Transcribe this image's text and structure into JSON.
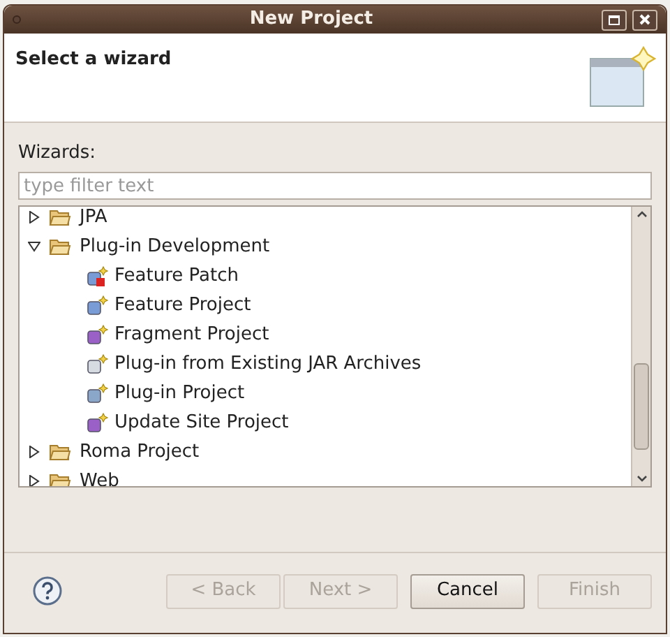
{
  "window": {
    "title": "New Project"
  },
  "header": {
    "title": "Select a wizard"
  },
  "wizards_label": {
    "text": "Wizards:"
  },
  "filter": {
    "placeholder": "type filter text"
  },
  "tree": [
    {
      "label": "JPA",
      "kind": "folder",
      "expanded": false
    },
    {
      "label": "Plug-in Development",
      "kind": "folder",
      "expanded": true,
      "children": [
        {
          "label": "Feature Patch",
          "kind": "feature-patch"
        },
        {
          "label": "Feature Project",
          "kind": "feature"
        },
        {
          "label": "Fragment Project",
          "kind": "fragment"
        },
        {
          "label": "Plug-in from Existing JAR Archives",
          "kind": "jar"
        },
        {
          "label": "Plug-in Project",
          "kind": "plugin"
        },
        {
          "label": "Update Site Project",
          "kind": "site"
        }
      ]
    },
    {
      "label": "Roma Project",
      "kind": "folder",
      "expanded": false
    },
    {
      "label": "Web",
      "kind": "folder",
      "expanded": false
    }
  ],
  "buttons": [
    {
      "label": "< Back",
      "disabled": true
    },
    {
      "label": "Next >",
      "disabled": true
    },
    {
      "label": "Cancel",
      "disabled": false
    },
    {
      "label": "Finish",
      "disabled": true
    }
  ]
}
